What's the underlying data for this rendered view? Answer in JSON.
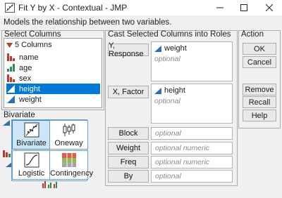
{
  "window": {
    "title": "Fit Y by X - Contextual - JMP",
    "description": "Models the relationship between two variables."
  },
  "select_columns": {
    "title": "Select Columns",
    "count_label": "5 Columns",
    "columns": [
      {
        "label": "name",
        "type": "nominal"
      },
      {
        "label": "age",
        "type": "ordinal"
      },
      {
        "label": "sex",
        "type": "nominal"
      },
      {
        "label": "height",
        "type": "continuous",
        "selected": true
      },
      {
        "label": "weight",
        "type": "continuous"
      }
    ]
  },
  "cast_roles": {
    "title": "Cast Selected Columns into Roles",
    "y_response": {
      "button": "Y, Response",
      "value": "weight",
      "hint": "optional"
    },
    "x_factor": {
      "button": "X, Factor",
      "value": "height",
      "hint": "optional"
    },
    "block": {
      "button": "Block",
      "hint": "optional"
    },
    "weight": {
      "button": "Weight",
      "hint": "optional numeric"
    },
    "freq": {
      "button": "Freq",
      "hint": "optional numeric"
    },
    "by": {
      "button": "By",
      "hint": "optional"
    }
  },
  "action": {
    "title": "Action",
    "ok": "OK",
    "cancel": "Cancel",
    "remove": "Remove",
    "recall": "Recall",
    "help": "Help"
  },
  "platform": {
    "title": "Bivariate",
    "tiles": [
      {
        "label": "Bivariate",
        "active": true
      },
      {
        "label": "Oneway",
        "active": false
      },
      {
        "label": "Logistic",
        "active": false
      },
      {
        "label": "Contingency",
        "active": false
      }
    ]
  },
  "colors": {
    "selection": "#0078d7",
    "tile_active": "#cde6f7",
    "nominal": "#c0392b",
    "ordinal": "#2e8b57",
    "continuous": "#2f6db5"
  }
}
